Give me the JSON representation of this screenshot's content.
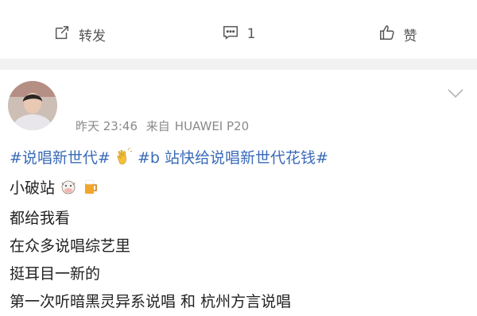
{
  "action_bar": {
    "repost_label": "转发",
    "comment_count": "1",
    "like_label": "赞"
  },
  "post": {
    "time": "昨天 23:46",
    "source_prefix": "来自",
    "source_device": "HUAWEI P20",
    "hashtag_1": "#说唱新世代#",
    "hashtag_2": "#b 站快给说唱新世代花钱#",
    "lines": [
      "小破站",
      "都给我看",
      "在众多说唱综艺里",
      "挺耳目一新的",
      "第一次听暗黑灵异系说唱 和 杭州方言说唱"
    ]
  },
  "colors": {
    "link": "#3a6bb8",
    "meta": "#8a8a8a",
    "divider": "#f2f2f2"
  }
}
